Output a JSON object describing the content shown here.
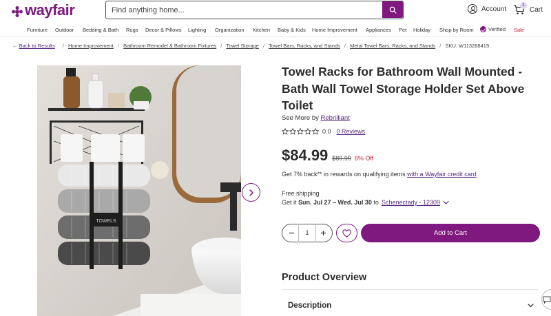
{
  "header": {
    "logo_text": "wayfair",
    "search_placeholder": "Find anything home...",
    "account_label": "Account",
    "cart_label": "Cart",
    "cart_count": "1"
  },
  "nav": {
    "items": [
      "Furniture",
      "Outdoor",
      "Bedding & Bath",
      "Rugs",
      "Decor & Pillows",
      "Lighting",
      "Organization",
      "Kitchen",
      "Baby & Kids",
      "Home Improvement",
      "Appliances",
      "Pet",
      "Holiday",
      "Shop by Room",
      "Verified",
      "Sale"
    ]
  },
  "breadcrumb": {
    "back": "Back to Results",
    "items": [
      "Home Improvement",
      "Bathroom Remodel & Bathroom Fixtures",
      "Towel Storage",
      "Towel Bars, Racks, and Stands",
      "Metal Towel Bars, Racks, and Stands"
    ],
    "sku": "SKU: W113268419"
  },
  "product": {
    "title": "Towel Racks for Bathroom Wall Mounted - Bath Wall Towel Storage Holder Set Above Toilet",
    "see_more_prefix": "See More by",
    "brand": "Rebrilliant",
    "rating_value": "0.0",
    "rating_fraction": 0,
    "reviews_link": "0 Reviews",
    "price": "$84.99",
    "was_price": "$89.99",
    "discount": "6% Off",
    "rewards_text": "Get 7% back** in rewards on qualifying items",
    "rewards_link": "with a Wayfair credit card",
    "shipping_label": "Free shipping",
    "delivery_prefix": "Get it",
    "delivery_dates": "Sun. Jul 27 – Wed. Jul 30",
    "delivery_to": "to",
    "delivery_location": "Schenectady - 12309",
    "quantity": "1",
    "add_to_cart": "Add to Cart",
    "towel_label": "TOWELS"
  },
  "sections": {
    "overview_title": "Product Overview",
    "description_label": "Description"
  },
  "colors": {
    "brand": "#7f187f",
    "sale": "#c7202c"
  },
  "icons": [
    "search-icon",
    "account-icon",
    "cart-icon",
    "verified-icon",
    "back-arrow-icon",
    "chevron-right-icon",
    "star-icon",
    "chevron-down-icon",
    "minus-icon",
    "plus-icon",
    "heart-icon",
    "chat-icon"
  ]
}
